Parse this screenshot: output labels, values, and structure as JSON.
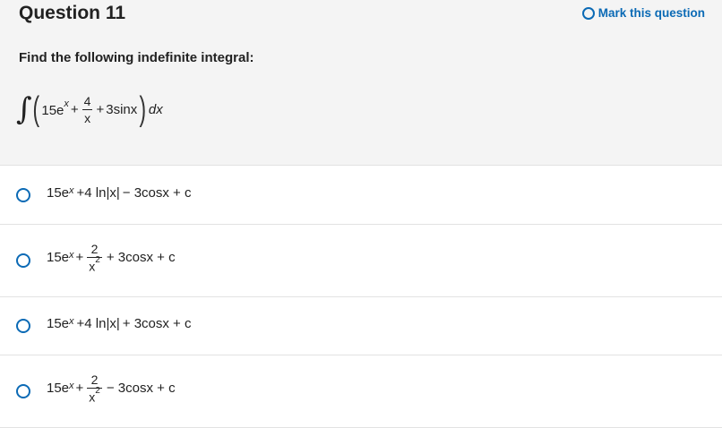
{
  "question": {
    "title": "Question 11",
    "mark_label": "Mark this question",
    "prompt": "Find the following indefinite integral:"
  },
  "integral": {
    "t1": "15e",
    "t1_exp": "x",
    "plus1": "+",
    "num": "4",
    "den": "x",
    "plus2": "+",
    "t3": "3sinx",
    "dx": "dx"
  },
  "options": [
    {
      "pre": "15e",
      "exp": "x",
      "mid": "+4 ln",
      "abs": "|x|",
      "rest": "− 3cosx + c"
    },
    {
      "pre": "15e",
      "exp": "x",
      "plus": "+",
      "num": "2",
      "den": "x",
      "den_exp": "2",
      "rest": "+ 3cosx + c"
    },
    {
      "pre": "15e",
      "exp": "x",
      "mid": "+4 ln",
      "abs": "|x|",
      "rest": "+ 3cosx + c"
    },
    {
      "pre": "15e",
      "exp": "x",
      "plus": "+",
      "num": "2",
      "den": "x",
      "den_exp": "2",
      "rest": "− 3cosx + c"
    }
  ],
  "colors": {
    "accent": "#0b6ab5",
    "header_bg": "#f4f4f4",
    "divider": "#e2e2e2"
  },
  "icons": {
    "radio": "radio-circle-icon",
    "mark": "circle-outline-icon"
  }
}
